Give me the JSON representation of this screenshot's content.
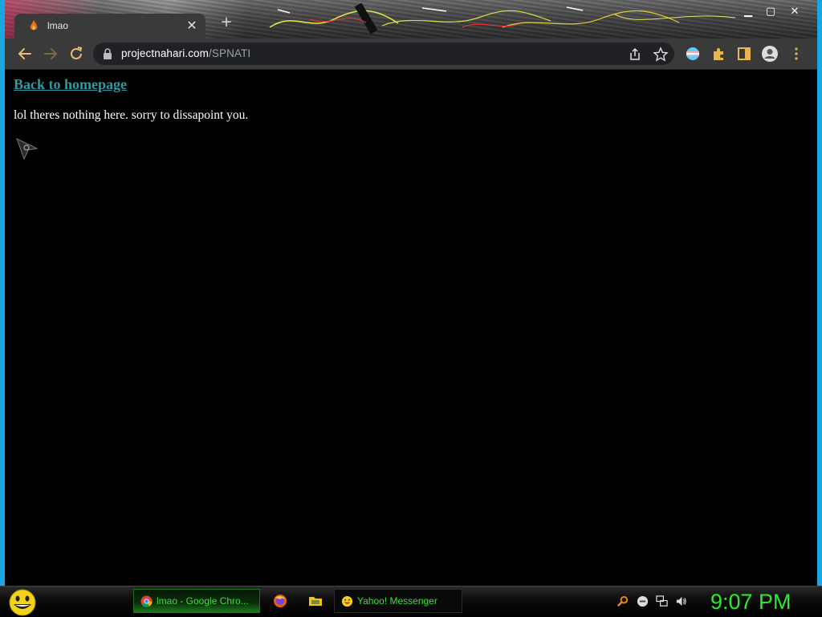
{
  "browser": {
    "tab": {
      "title": "lmao",
      "favicon": "flame-icon"
    },
    "window_controls": [
      "minimize-icon",
      "maximize-icon",
      "close-icon"
    ],
    "address_bar": {
      "domain": "projectnahari.com",
      "path": "/SPNATI"
    },
    "toolbar_icons": [
      "back-arrow-icon",
      "forward-arrow-icon",
      "reload-icon",
      "share-icon",
      "bookmark-star-icon",
      "flag-icon",
      "extensions-puzzle-icon",
      "side-panel-icon",
      "profile-avatar-icon",
      "more-menu-icon"
    ],
    "colors": {
      "toolbar": "#3a3a3a",
      "omnibox": "#202124",
      "link": "#2e9aa6"
    }
  },
  "page": {
    "link_text": "Back to homepage",
    "body_text": "lol theres nothing here. sorry to dissapoint you."
  },
  "taskbar": {
    "items": [
      {
        "label": "lmao - Google Chro...",
        "icon": "chrome-icon",
        "active": true
      },
      {
        "label": "Yahoo! Messenger",
        "icon": "yahoo-smiley-icon",
        "active": false
      }
    ],
    "quick_launch": [
      "firefox-icon",
      "folder-icon"
    ],
    "tray": [
      "search-icon",
      "minus-circle-icon",
      "network-icon",
      "volume-icon"
    ],
    "clock": "9:07 PM",
    "colors": {
      "text": "#3de03d",
      "clock": "#2ee82e"
    }
  }
}
